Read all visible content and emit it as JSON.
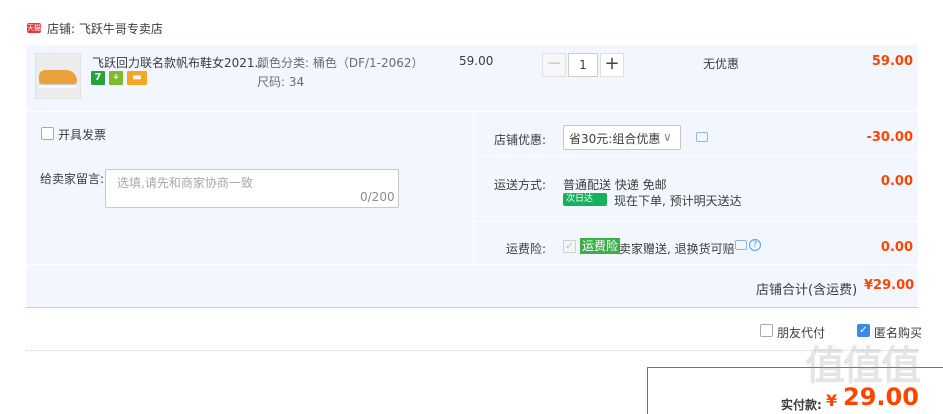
{
  "store": {
    "icon_text": "天猫",
    "name": "店铺: 飞跃牛哥专卖店"
  },
  "item": {
    "title": "飞跃回力联名款帆布鞋女2021...",
    "badges": [
      "7",
      "⚘",
      "▬"
    ],
    "props": [
      "颜色分类: 桶色（DF/1-2062）",
      "尺码: 34"
    ],
    "price": "59.00",
    "qty": {
      "minus": "−",
      "value": "1",
      "plus": "+"
    },
    "discount": "无优惠",
    "subtotal": "59.00"
  },
  "options": {
    "invoice_label": "开具发票",
    "message_label": "给卖家留言:",
    "message_placeholder": "选填,请先和商家协商一致",
    "message_count": "0/200",
    "coupon": {
      "label": "店铺优惠:",
      "selected": "省30元:组合优惠",
      "chevron": "∨",
      "amount": "-30.00"
    },
    "shipping": {
      "label": "运送方式:",
      "method": "普通配送 快递 免邮",
      "badge": "次日达",
      "note": "现在下单, 预计明天送达",
      "amount": "0.00"
    },
    "insurance": {
      "label": "运费险:",
      "check": "✓",
      "badge": "运费险",
      "text": "卖家赠送, 退换货可赔",
      "help": "?",
      "amount": "0.00"
    },
    "store_total_label": "店铺合计(含运费)",
    "store_total_amount": "¥29.00"
  },
  "footer": {
    "friend_pay_label": "朋友代付",
    "anonymous_label": "匿名购买",
    "anonymous_check": "✓",
    "pay_label": "实付款:",
    "pay_currency": "¥",
    "pay_amount": "29.00",
    "watermark": "值值值"
  }
}
